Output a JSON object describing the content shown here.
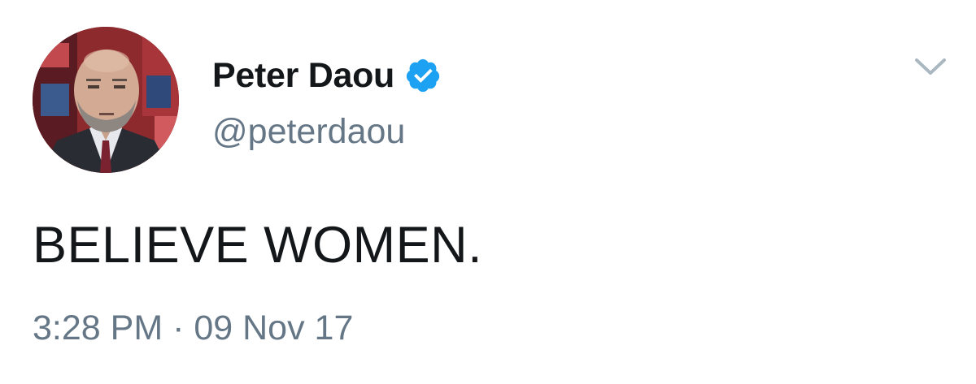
{
  "user": {
    "display_name": "Peter Daou",
    "handle": "@peterdaou",
    "verified": true,
    "avatar_alt": "profile-photo"
  },
  "tweet": {
    "text": "BELIEVE WOMEN.",
    "timestamp": "3:28 PM · 09 Nov 17"
  },
  "icons": {
    "verified_badge": "verified-badge-icon",
    "menu": "chevron-down-icon"
  },
  "colors": {
    "name": "#14171a",
    "secondary": "#657786",
    "verified_blue": "#1da1f2",
    "chevron": "#aab8c2",
    "background": "#ffffff"
  }
}
